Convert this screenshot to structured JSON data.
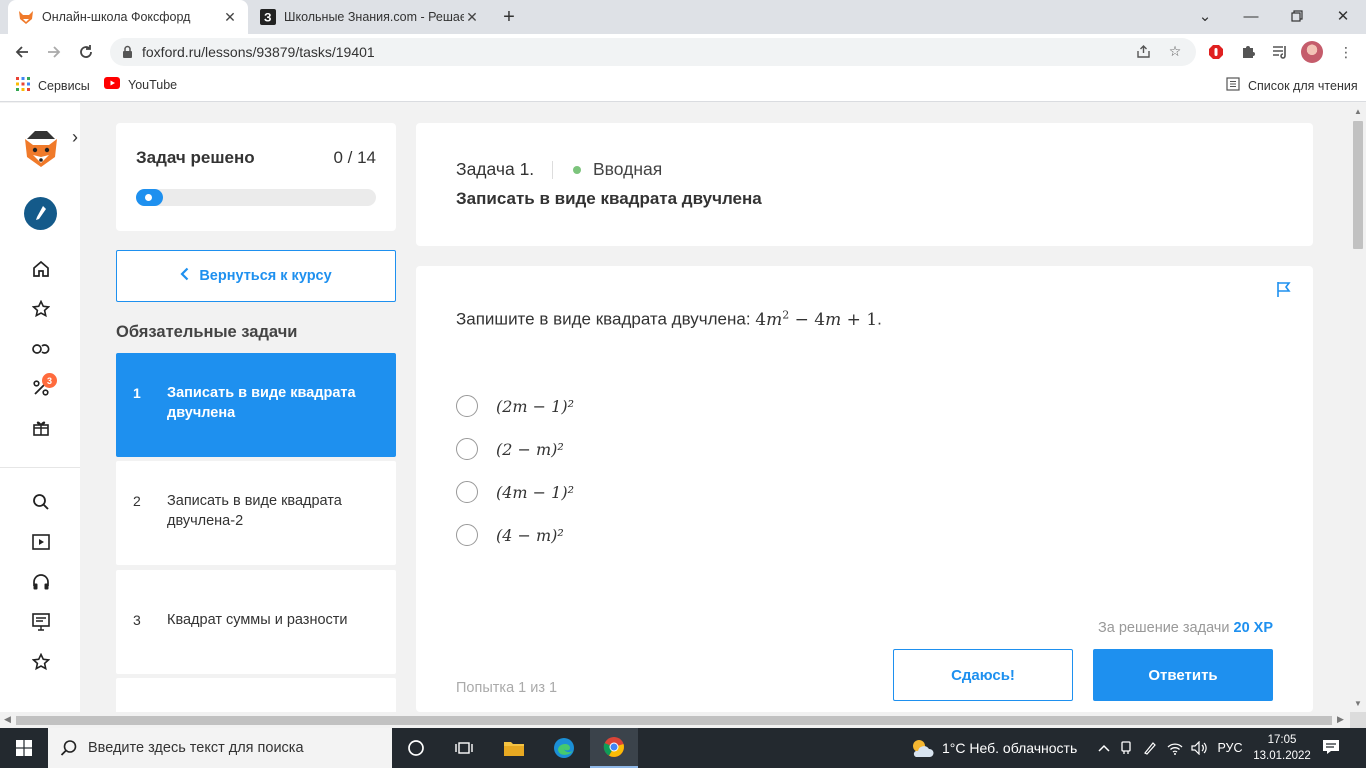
{
  "browser": {
    "tabs": [
      {
        "title": "Онлайн-школа Фоксфорд",
        "active": true
      },
      {
        "title": "Школьные Знания.com - Решае",
        "active": false
      }
    ],
    "url": "foxford.ru/lessons/93879/tasks/19401",
    "bookmarks": [
      {
        "label": "Сервисы"
      },
      {
        "label": "YouTube"
      }
    ],
    "reading_list": "Список для чтения"
  },
  "sidebar": {
    "progress_label": "Задач решено",
    "progress_count": "0 / 14",
    "progress_fraction": 0,
    "back_label": "Вернуться к курсу",
    "section_title": "Обязательные задачи",
    "notification_badge": "3",
    "tasks": [
      {
        "num": "1",
        "name": "Записать в виде квадрата двучлена",
        "active": true
      },
      {
        "num": "2",
        "name": "Записать в виде квадрата двучлена-2",
        "active": false
      },
      {
        "num": "3",
        "name": "Квадрат суммы и разности",
        "active": false
      }
    ]
  },
  "task": {
    "number": "Задача 1.",
    "level": "Вводная",
    "title": "Записать в виде квадрата двучлена",
    "question": "Запишите в виде квадрата двучлена:",
    "options": [
      "(2m − 1)²",
      "(2 − m)²",
      "(4m − 1)²",
      "(4 − m)²"
    ],
    "reward_label": "За решение задачи",
    "reward_value": "20 XP",
    "giveup_label": "Сдаюсь!",
    "answer_label": "Ответить",
    "attempt": "Попытка 1 из 1"
  },
  "taskbar": {
    "search_placeholder": "Введите здесь текст для поиска",
    "weather": "1°C  Неб. облачность",
    "lang": "РУС",
    "time": "17:05",
    "date": "13.01.2022"
  },
  "colors": {
    "accent": "#1e90ef",
    "level_dot": "#7cc47c",
    "badge": "#ff6b3d"
  }
}
